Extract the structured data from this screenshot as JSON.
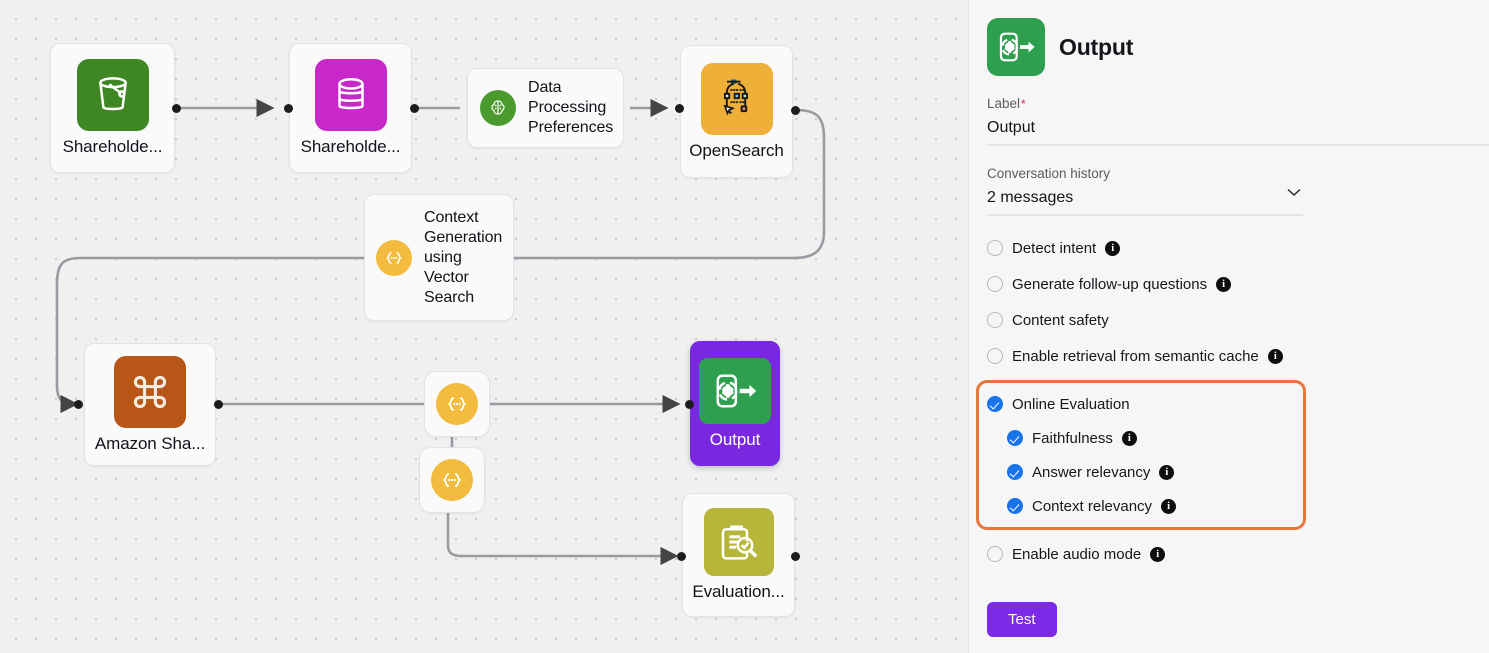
{
  "canvas": {
    "nodes": [
      {
        "id": "shareholder-s3",
        "label": "Shareholde...",
        "icon": "s3-bucket-icon",
        "color": "#3f8624"
      },
      {
        "id": "shareholder-db",
        "label": "Shareholde...",
        "icon": "database-icon",
        "color": "#c928c9"
      },
      {
        "id": "data-processing",
        "label": "Data Processing Preferences",
        "icon": "brain-gear-icon",
        "color": "#4b9a2e"
      },
      {
        "id": "opensearch",
        "label": "OpenSearch",
        "icon": "opensearch-icon",
        "color": "#efb03a"
      },
      {
        "id": "context-gen",
        "label": "Context Generation using Vector Search",
        "icon": "prompt-braces-icon",
        "color": "#f3bc3e"
      },
      {
        "id": "amazon-shared",
        "label": "Amazon Sha...",
        "icon": "amazon-command-icon",
        "color": "#b85618"
      },
      {
        "id": "prompt-node-1",
        "label": "",
        "icon": "prompt-braces-icon",
        "color": "#f3bc3e"
      },
      {
        "id": "prompt-node-2",
        "label": "",
        "icon": "prompt-braces-icon",
        "color": "#f3bc3e"
      },
      {
        "id": "output",
        "label": "Output",
        "icon": "output-gear-arrow-icon",
        "color": "#2e9e4f",
        "selected": true
      },
      {
        "id": "evaluation",
        "label": "Evaluation...",
        "icon": "evaluation-clipboard-icon",
        "color": "#b5b63a"
      }
    ]
  },
  "panel": {
    "title": "Output",
    "icon": "output-gear-arrow-icon",
    "label_field": {
      "label": "Label",
      "required_mark": "*",
      "value": "Output"
    },
    "conversation_history": {
      "label": "Conversation history",
      "value": "2 messages",
      "chevron": "chevron-down-icon"
    },
    "options": [
      {
        "id": "detect-intent",
        "label": "Detect intent",
        "checked": false,
        "info": true
      },
      {
        "id": "follow-up",
        "label": "Generate follow-up questions",
        "checked": false,
        "info": true
      },
      {
        "id": "content-safety",
        "label": "Content safety",
        "checked": false,
        "info": false
      },
      {
        "id": "semantic-cache",
        "label": "Enable retrieval from semantic cache",
        "checked": false,
        "info": true
      }
    ],
    "highlighted_group": {
      "parent": {
        "id": "online-evaluation",
        "label": "Online Evaluation",
        "checked": true,
        "info": false
      },
      "children": [
        {
          "id": "faithfulness",
          "label": "Faithfulness",
          "checked": true,
          "info": true
        },
        {
          "id": "answer-relevancy",
          "label": "Answer relevancy",
          "checked": true,
          "info": true
        },
        {
          "id": "context-relevancy",
          "label": "Context relevancy",
          "checked": true,
          "info": true
        }
      ],
      "border_color": "#e8763c"
    },
    "audio_option": {
      "id": "audio-mode",
      "label": "Enable audio mode",
      "checked": false,
      "info": true
    },
    "test_button": {
      "label": "Test",
      "color": "#7c2ae8"
    }
  }
}
